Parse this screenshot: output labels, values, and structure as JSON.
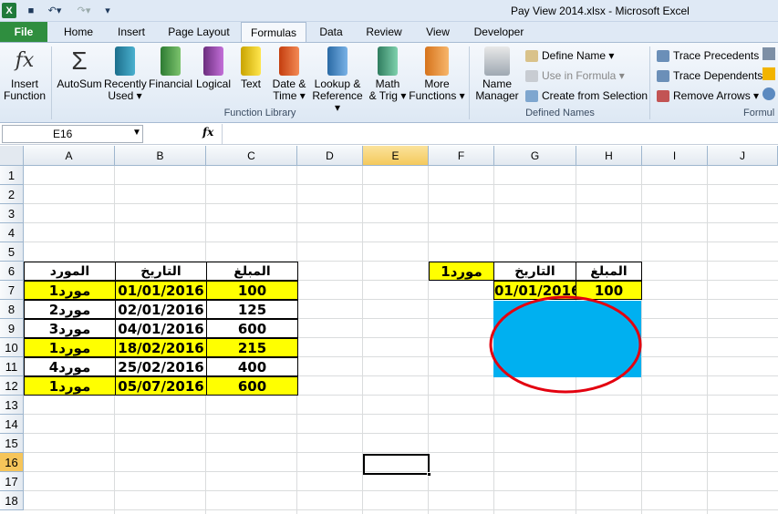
{
  "window": {
    "title": "Pay View 2014.xlsx  -  Microsoft Excel"
  },
  "tabs": [
    {
      "label": "File"
    },
    {
      "label": "Home"
    },
    {
      "label": "Insert"
    },
    {
      "label": "Page Layout"
    },
    {
      "label": "Formulas"
    },
    {
      "label": "Data"
    },
    {
      "label": "Review"
    },
    {
      "label": "View"
    },
    {
      "label": "Developer"
    }
  ],
  "ribbon": {
    "insert_function": {
      "line1": "Insert",
      "line2": "Function"
    },
    "library": [
      {
        "line1": "AutoSum",
        "line2": "",
        "icon": "sigma-icon"
      },
      {
        "line1": "Recently",
        "line2": "Used ▾",
        "icon": "star-book-icon"
      },
      {
        "line1": "Financial",
        "line2": "",
        "icon": "financial-book-icon"
      },
      {
        "line1": "Logical",
        "line2": "",
        "icon": "logical-book-icon"
      },
      {
        "line1": "Text",
        "line2": "",
        "icon": "text-book-icon"
      },
      {
        "line1": "Date &",
        "line2": "Time ▾",
        "icon": "calendar-book-icon"
      },
      {
        "line1": "Lookup &",
        "line2": "Reference ▾",
        "icon": "lookup-book-icon"
      },
      {
        "line1": "Math",
        "line2": "& Trig ▾",
        "icon": "math-book-icon"
      },
      {
        "line1": "More",
        "line2": "Functions ▾",
        "icon": "more-books-icon"
      }
    ],
    "function_library_label": "Function Library",
    "name_manager": {
      "line1": "Name",
      "line2": "Manager"
    },
    "define_name": "Define Name ▾",
    "use_in_formula": "Use in Formula ▾",
    "create_from_selection": "Create from Selection",
    "defined_names_label": "Defined Names",
    "trace_precedents": "Trace Precedents",
    "trace_dependents": "Trace Dependents",
    "remove_arrows": "Remove Arrows ▾",
    "formula_auditing_label": "Formul"
  },
  "formula_bar": {
    "name_box": "E16",
    "fx": "fx",
    "formula": ""
  },
  "columns": [
    "A",
    "B",
    "C",
    "D",
    "E",
    "F",
    "G",
    "H",
    "I",
    "J"
  ],
  "selected_column": "E",
  "rows": [
    "1",
    "2",
    "3",
    "4",
    "5",
    "6",
    "7",
    "8",
    "9",
    "10",
    "11",
    "12",
    "13",
    "14",
    "15",
    "16",
    "17",
    "18"
  ],
  "selected_row": "16",
  "table_left": {
    "headers": [
      "المورد",
      "التاريخ",
      "المبلغ"
    ],
    "rows": [
      {
        "supplier": "مورد1",
        "date": "01/01/2016",
        "amount": "100",
        "highlight": true
      },
      {
        "supplier": "مورد2",
        "date": "02/01/2016",
        "amount": "125",
        "highlight": false
      },
      {
        "supplier": "مورد3",
        "date": "04/01/2016",
        "amount": "600",
        "highlight": false
      },
      {
        "supplier": "مورد1",
        "date": "18/02/2016",
        "amount": "215",
        "highlight": true
      },
      {
        "supplier": "مورد4",
        "date": "25/02/2016",
        "amount": "400",
        "highlight": false
      },
      {
        "supplier": "مورد1",
        "date": "05/07/2016",
        "amount": "600",
        "highlight": true
      }
    ]
  },
  "table_right": {
    "criteria": "مورد1",
    "headers": [
      "التاريخ",
      "المبلغ"
    ],
    "row": {
      "date": "01/01/2016",
      "amount": "100"
    }
  },
  "colors": {
    "highlight_yellow": "#ffff00",
    "blue_fill": "#00b0f0",
    "annotation_red": "#e3000f",
    "file_tab_green": "#2f8e3f"
  }
}
